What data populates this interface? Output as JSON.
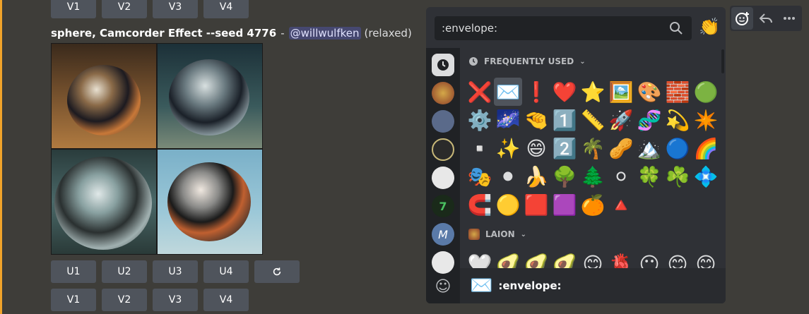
{
  "top_buttons": [
    "V1",
    "V2",
    "V3",
    "V4"
  ],
  "message": {
    "prompt": "sphere, Camcorder Effect --seed 4776",
    "dash": "-",
    "mention": "@willwulfken",
    "status": "(relaxed)"
  },
  "upscale_buttons": [
    "U1",
    "U2",
    "U3",
    "U4"
  ],
  "refresh_icon": "refresh-icon",
  "variation_buttons": [
    "V1",
    "V2",
    "V3",
    "V4"
  ],
  "emoji_picker": {
    "search_value": ":envelope:",
    "frequently_used_label": "FREQUENTLY USED",
    "laion_label": "LAION",
    "footer_name": ":envelope:",
    "footer_emoji": "✉️",
    "frequently_used": [
      "❌",
      "✉️",
      "❗",
      "❤️",
      "⭐",
      "🖼️",
      "🎨",
      "🧱",
      "🟢",
      "⚙️",
      "🌌",
      "🤏",
      "1️⃣",
      "📏",
      "🚀",
      "🧬",
      "💫",
      "✴️",
      "▫️",
      "✨",
      "😄",
      "2️⃣",
      "🌴",
      "🥜",
      "🏔️",
      "🔵",
      "🌈",
      "🎭",
      "⚫",
      "🍌",
      "🌳",
      "🌲",
      "⚪",
      "🍀",
      "☘️",
      "💠",
      "🧲",
      "🟡",
      "🟥",
      "🟪",
      "🍊",
      "🔺"
    ],
    "laion": [
      "🤍",
      "🥑",
      "🥑",
      "🥑",
      "😊",
      "🫀",
      "😶",
      "😊",
      "😊"
    ]
  },
  "toolbar": {
    "add_reaction_icon": "add-reaction-icon",
    "reply_icon": "reply-icon",
    "more_icon": "more-icon"
  },
  "colors": {
    "background": "#3e3d39",
    "button": "#4f545c",
    "panel": "#2f3136",
    "accent": "#f0a32a",
    "mention_bg": "#5865f2"
  }
}
